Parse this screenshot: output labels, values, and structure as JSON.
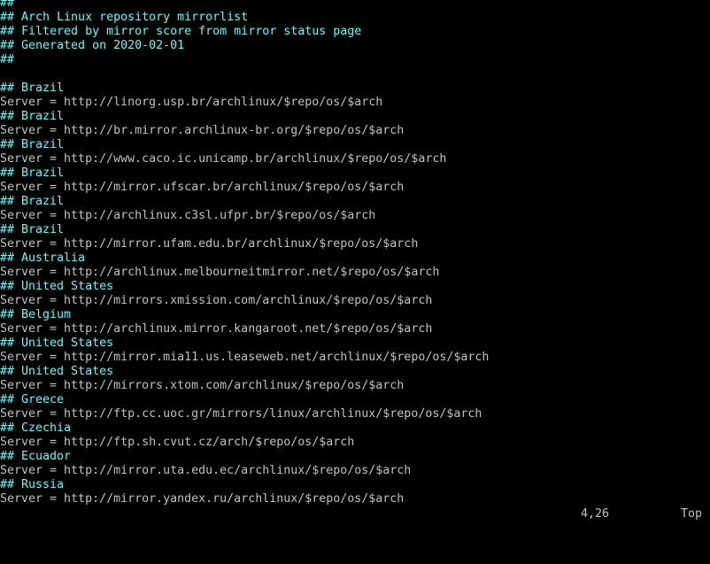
{
  "editor": {
    "lines": [
      {
        "kind": "comment",
        "text": "##"
      },
      {
        "kind": "comment",
        "text": "## Arch Linux repository mirrorlist"
      },
      {
        "kind": "comment",
        "text": "## Filtered by mirror score from mirror status page"
      },
      {
        "kind": "comment",
        "text": "## Generated on 2020-02-01"
      },
      {
        "kind": "comment",
        "text": "##"
      },
      {
        "kind": "blank",
        "text": ""
      },
      {
        "kind": "comment",
        "text": "## Brazil"
      },
      {
        "kind": "server",
        "text": "Server = http://linorg.usp.br/archlinux/$repo/os/$arch"
      },
      {
        "kind": "comment",
        "text": "## Brazil"
      },
      {
        "kind": "server",
        "text": "Server = http://br.mirror.archlinux-br.org/$repo/os/$arch"
      },
      {
        "kind": "comment",
        "text": "## Brazil"
      },
      {
        "kind": "server",
        "text": "Server = http://www.caco.ic.unicamp.br/archlinux/$repo/os/$arch"
      },
      {
        "kind": "comment",
        "text": "## Brazil"
      },
      {
        "kind": "server",
        "text": "Server = http://mirror.ufscar.br/archlinux/$repo/os/$arch"
      },
      {
        "kind": "comment",
        "text": "## Brazil"
      },
      {
        "kind": "server",
        "text": "Server = http://archlinux.c3sl.ufpr.br/$repo/os/$arch"
      },
      {
        "kind": "comment",
        "text": "## Brazil"
      },
      {
        "kind": "server",
        "text": "Server = http://mirror.ufam.edu.br/archlinux/$repo/os/$arch"
      },
      {
        "kind": "comment",
        "text": "## Australia"
      },
      {
        "kind": "server",
        "text": "Server = http://archlinux.melbourneitmirror.net/$repo/os/$arch"
      },
      {
        "kind": "comment",
        "text": "## United States"
      },
      {
        "kind": "server",
        "text": "Server = http://mirrors.xmission.com/archlinux/$repo/os/$arch"
      },
      {
        "kind": "comment",
        "text": "## Belgium"
      },
      {
        "kind": "server",
        "text": "Server = http://archlinux.mirror.kangaroot.net/$repo/os/$arch"
      },
      {
        "kind": "comment",
        "text": "## United States"
      },
      {
        "kind": "server",
        "text": "Server = http://mirror.mia11.us.leaseweb.net/archlinux/$repo/os/$arch"
      },
      {
        "kind": "comment",
        "text": "## United States"
      },
      {
        "kind": "server",
        "text": "Server = http://mirrors.xtom.com/archlinux/$repo/os/$arch"
      },
      {
        "kind": "comment",
        "text": "## Greece"
      },
      {
        "kind": "server",
        "text": "Server = http://ftp.cc.uoc.gr/mirrors/linux/archlinux/$repo/os/$arch"
      },
      {
        "kind": "comment",
        "text": "## Czechia"
      },
      {
        "kind": "server",
        "text": "Server = http://ftp.sh.cvut.cz/arch/$repo/os/$arch"
      },
      {
        "kind": "comment",
        "text": "## Ecuador"
      },
      {
        "kind": "server",
        "text": "Server = http://mirror.uta.edu.ec/archlinux/$repo/os/$arch"
      },
      {
        "kind": "comment",
        "text": "## Russia"
      },
      {
        "kind": "server",
        "text": "Server = http://mirror.yandex.ru/archlinux/$repo/os/$arch"
      }
    ]
  },
  "status_line": {
    "cursor_position": "4,26",
    "scroll_position": "Top"
  },
  "colors": {
    "background": "#000000",
    "comment": "#55ffff",
    "text": "#c0c0c0"
  }
}
